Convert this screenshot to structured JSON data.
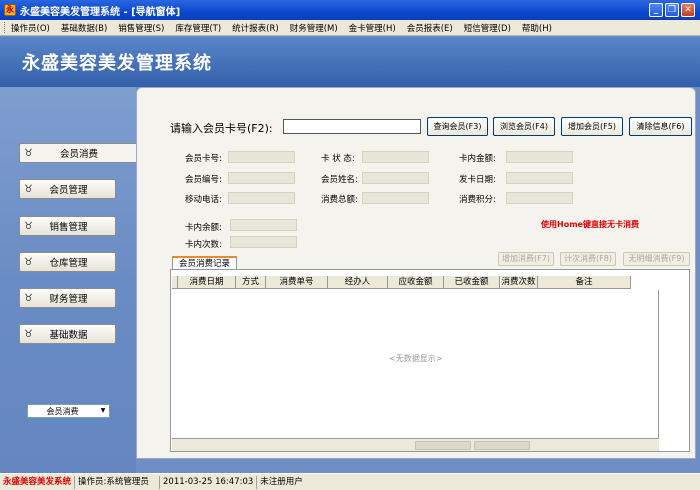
{
  "window": {
    "title": "永盛美容美发管理系统 - [导航窗体]",
    "minimize": "_",
    "restore": "❐",
    "close": "✕"
  },
  "menu": [
    "操作员(O)",
    "基础数据(B)",
    "销售管理(S)",
    "库存管理(T)",
    "统计报表(R)",
    "财务管理(M)",
    "金卡管理(H)",
    "会员报表(E)",
    "短信管理(D)",
    "帮助(H)"
  ],
  "banner": {
    "title": "永盛美容美发管理系统"
  },
  "sidebar": {
    "items": [
      {
        "label": "会员消费",
        "icon": "bull-head-icon"
      },
      {
        "label": "会员管理",
        "icon": "bull-head-icon"
      },
      {
        "label": "销售管理",
        "icon": "bull-head-icon"
      },
      {
        "label": "仓库管理",
        "icon": "bull-head-icon"
      },
      {
        "label": "财务管理",
        "icon": "bull-head-icon"
      },
      {
        "label": "基础数据",
        "icon": "bull-head-icon"
      }
    ],
    "select_value": "会员消费"
  },
  "form": {
    "card_prompt": "请输入会员卡号(F2):",
    "buttons": {
      "query": "查询会员(F3)",
      "browse": "浏览会员(F4)",
      "add": "增加会员(F5)",
      "clear": "清除信息(F6)"
    },
    "fields": {
      "card_no": "会员卡号:",
      "card_status": "卡 状 态:",
      "card_amount": "卡内金额:",
      "member_no": "会员编号:",
      "member_name": "会员姓名:",
      "issue_date": "发卡日期:",
      "mobile": "移动电话:",
      "total_spend": "消费总额:",
      "points": "消费积分:",
      "card_balance": "卡内余额:",
      "card_times": "卡内次数:"
    },
    "hint": "使用Home键直接无卡消费"
  },
  "records": {
    "tab_label": "会员消费记录",
    "buttons": {
      "add_spend": "增加消费(F7)",
      "count_spend": "计次消费(F8)",
      "detail_spend": "无明细消费(F9)"
    },
    "columns": [
      "消费日期",
      "方式",
      "消费单号",
      "经办人",
      "应收金额",
      "已收金额",
      "消费次数",
      "备注"
    ],
    "empty_text": "<无数据显示>"
  },
  "status": {
    "brand": "永盛美容美发系统",
    "operator": "操作员:系统管理员",
    "datetime": "2011-03-25 16:47:03",
    "license": "未注册用户"
  }
}
